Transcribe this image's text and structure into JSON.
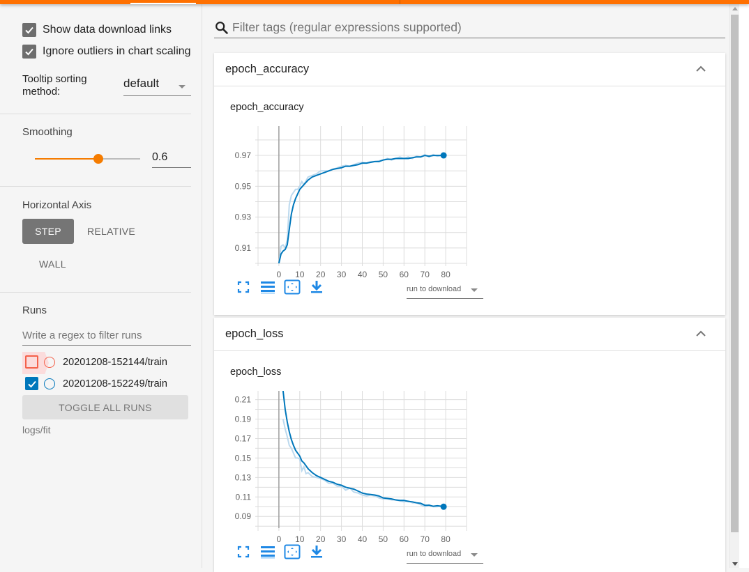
{
  "sidebar": {
    "show_download_links": {
      "label": "Show data download links",
      "checked": true
    },
    "ignore_outliers": {
      "label": "Ignore outliers in chart scaling",
      "checked": true
    },
    "tooltip_sorting": {
      "label": "Tooltip sorting method:",
      "value": "default"
    },
    "smoothing": {
      "title": "Smoothing",
      "value": "0.6",
      "fraction": 0.6
    },
    "horizontal_axis": {
      "title": "Horizontal Axis",
      "options": [
        "STEP",
        "RELATIVE",
        "WALL"
      ],
      "selected": "STEP"
    },
    "runs": {
      "title": "Runs",
      "filter_placeholder": "Write a regex to filter runs",
      "items": [
        {
          "name": "20201208-152144/train",
          "checked": false,
          "color": "#f4614a"
        },
        {
          "name": "20201208-152249/train",
          "checked": true,
          "color": "#0077bb"
        }
      ],
      "toggle_all_label": "TOGGLE ALL RUNS",
      "logdir": "logs/fit"
    }
  },
  "main": {
    "filter_placeholder": "Filter tags (regular expressions supported)",
    "cards": [
      {
        "title": "epoch_accuracy",
        "chart_title": "epoch_accuracy",
        "download_label": "run to download"
      },
      {
        "title": "epoch_loss",
        "chart_title": "epoch_loss",
        "download_label": "run to download"
      }
    ]
  },
  "colors": {
    "accent": "#ff7000",
    "slider": "#f57c00",
    "series": "#0077bb",
    "series_raw": "#bcd9ee",
    "tool_icons": "#1e88e5"
  },
  "chart_data": [
    {
      "type": "line",
      "title": "epoch_accuracy",
      "xlabel": "",
      "ylabel": "",
      "xlim": [
        -10,
        90
      ],
      "ylim": [
        0.9,
        0.989
      ],
      "xticks": [
        0,
        10,
        20,
        30,
        40,
        50,
        60,
        70,
        80
      ],
      "yticks": [
        0.91,
        0.93,
        0.95,
        0.97
      ],
      "ytick_labels": [
        "0.91",
        "0.93",
        "0.95",
        "0.97"
      ],
      "grid": true,
      "legend": "none",
      "series": [
        {
          "name": "20201208-152249/train (smoothed)",
          "x": [
            0,
            1,
            2,
            3,
            4,
            5,
            6,
            7,
            8,
            9,
            10,
            12,
            14,
            16,
            18,
            20,
            22,
            24,
            26,
            28,
            30,
            32,
            34,
            36,
            38,
            40,
            42,
            44,
            46,
            48,
            50,
            52,
            54,
            56,
            58,
            60,
            62,
            64,
            66,
            68,
            70,
            72,
            74,
            76,
            78,
            79
          ],
          "y": [
            0.9,
            0.906,
            0.908,
            0.909,
            0.912,
            0.922,
            0.932,
            0.938,
            0.942,
            0.945,
            0.948,
            0.951,
            0.954,
            0.956,
            0.957,
            0.958,
            0.959,
            0.96,
            0.961,
            0.9615,
            0.962,
            0.963,
            0.963,
            0.9635,
            0.964,
            0.965,
            0.965,
            0.9655,
            0.966,
            0.966,
            0.967,
            0.9675,
            0.9675,
            0.968,
            0.968,
            0.968,
            0.968,
            0.9685,
            0.969,
            0.969,
            0.97,
            0.9695,
            0.97,
            0.97,
            0.97,
            0.97
          ]
        },
        {
          "name": "20201208-152249/train (raw)",
          "x": [
            0,
            1,
            2,
            3,
            4,
            5,
            6,
            7,
            8,
            9,
            10,
            11,
            12,
            14,
            16,
            18,
            20,
            22,
            24,
            26,
            28,
            30,
            32,
            34,
            36,
            38,
            40,
            42,
            44,
            46,
            48,
            50,
            52,
            54,
            56,
            58,
            60,
            62,
            64,
            66,
            68,
            70,
            72,
            74,
            76,
            78,
            79
          ],
          "y": [
            0.9,
            0.911,
            0.912,
            0.91,
            0.915,
            0.938,
            0.944,
            0.946,
            0.948,
            0.948,
            0.95,
            0.953,
            0.951,
            0.956,
            0.957,
            0.958,
            0.96,
            0.96,
            0.96,
            0.961,
            0.962,
            0.963,
            0.9635,
            0.963,
            0.964,
            0.965,
            0.9655,
            0.965,
            0.966,
            0.966,
            0.9665,
            0.967,
            0.968,
            0.967,
            0.968,
            0.969,
            0.968,
            0.969,
            0.968,
            0.9695,
            0.969,
            0.9705,
            0.969,
            0.9705,
            0.9695,
            0.97,
            0.97
          ]
        }
      ]
    },
    {
      "type": "line",
      "title": "epoch_loss",
      "xlabel": "",
      "ylabel": "",
      "xlim": [
        -10,
        90
      ],
      "ylim": [
        0.078,
        0.219
      ],
      "xticks": [
        0,
        10,
        20,
        30,
        40,
        50,
        60,
        70,
        80
      ],
      "yticks": [
        0.09,
        0.11,
        0.13,
        0.15,
        0.17,
        0.19,
        0.21
      ],
      "ytick_labels": [
        "0.09",
        "0.11",
        "0.13",
        "0.15",
        "0.17",
        "0.19",
        "0.21"
      ],
      "grid": true,
      "legend": "none",
      "series": [
        {
          "name": "20201208-152249/train (smoothed)",
          "x": [
            2,
            3,
            4,
            5,
            6,
            7,
            8,
            9,
            10,
            11,
            12,
            13,
            14,
            16,
            18,
            20,
            22,
            24,
            26,
            28,
            30,
            32,
            34,
            36,
            38,
            40,
            42,
            44,
            46,
            48,
            50,
            52,
            54,
            56,
            58,
            60,
            62,
            64,
            66,
            68,
            70,
            72,
            74,
            76,
            78,
            79
          ],
          "y": [
            0.219,
            0.2,
            0.187,
            0.177,
            0.169,
            0.163,
            0.158,
            0.155,
            0.152,
            0.147,
            0.145,
            0.142,
            0.139,
            0.135,
            0.132,
            0.13,
            0.128,
            0.126,
            0.125,
            0.123,
            0.122,
            0.12,
            0.119,
            0.118,
            0.116,
            0.114,
            0.113,
            0.1125,
            0.112,
            0.111,
            0.109,
            0.1085,
            0.108,
            0.107,
            0.1065,
            0.1065,
            0.1055,
            0.105,
            0.104,
            0.1035,
            0.1015,
            0.1015,
            0.1005,
            0.101,
            0.1005,
            0.1
          ]
        },
        {
          "name": "20201208-152249/train (raw)",
          "x": [
            2,
            3,
            4,
            5,
            6,
            7,
            8,
            9,
            10,
            11,
            12,
            13,
            14,
            16,
            18,
            20,
            22,
            24,
            26,
            28,
            30,
            32,
            34,
            36,
            38,
            40,
            42,
            44,
            46,
            48,
            50,
            52,
            54,
            56,
            58,
            60,
            62,
            64,
            66,
            68,
            70,
            72,
            74,
            76,
            78,
            79
          ],
          "y": [
            0.19,
            0.18,
            0.172,
            0.163,
            0.16,
            0.155,
            0.15,
            0.15,
            0.149,
            0.137,
            0.141,
            0.134,
            0.135,
            0.131,
            0.13,
            0.129,
            0.127,
            0.124,
            0.124,
            0.121,
            0.121,
            0.117,
            0.119,
            0.115,
            0.114,
            0.112,
            0.111,
            0.112,
            0.111,
            0.109,
            0.108,
            0.108,
            0.107,
            0.107,
            0.106,
            0.105,
            0.106,
            0.104,
            0.104,
            0.102,
            0.1,
            0.102,
            0.1,
            0.1,
            0.101,
            0.1
          ]
        }
      ]
    }
  ]
}
